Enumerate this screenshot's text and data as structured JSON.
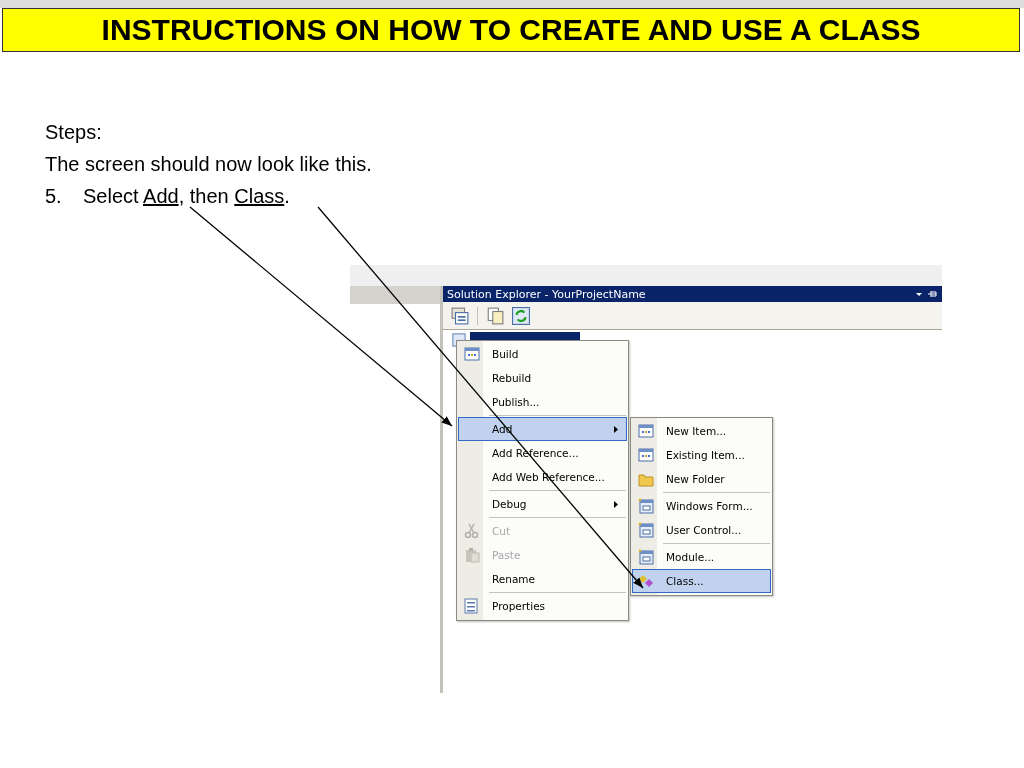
{
  "title": "INSTRUCTIONS ON HOW TO CREATE AND USE A CLASS",
  "lines": [
    {
      "parts": [
        {
          "text": "Steps:",
          "underlined": false
        }
      ]
    },
    {
      "parts": [
        {
          "text": "The screen should now look like this.",
          "underlined": false
        }
      ]
    },
    {
      "number": "5.",
      "parts": [
        {
          "text": "Select ",
          "underlined": false
        },
        {
          "text": "Add",
          "underlined": true
        },
        {
          "text": ", then ",
          "underlined": false
        },
        {
          "text": "Class",
          "underlined": true
        },
        {
          "text": ".",
          "underlined": false
        }
      ]
    }
  ],
  "solution_explorer": {
    "title": "Solution Explorer - YourProjectName"
  },
  "context_menu": [
    {
      "kind": "item",
      "label": "Build",
      "selected": false,
      "disabled": false,
      "submenu": false
    },
    {
      "kind": "item",
      "label": "Rebuild",
      "selected": false,
      "disabled": false,
      "submenu": false
    },
    {
      "kind": "item",
      "label": "Publish...",
      "selected": false,
      "disabled": false,
      "submenu": false
    },
    {
      "kind": "separator"
    },
    {
      "kind": "item",
      "label": "Add",
      "selected": true,
      "disabled": false,
      "submenu": true
    },
    {
      "kind": "item",
      "label": "Add Reference...",
      "selected": false,
      "disabled": false,
      "submenu": false
    },
    {
      "kind": "item",
      "label": "Add Web Reference...",
      "selected": false,
      "disabled": false,
      "submenu": false
    },
    {
      "kind": "separator"
    },
    {
      "kind": "item",
      "label": "Debug",
      "selected": false,
      "disabled": false,
      "submenu": true
    },
    {
      "kind": "separator"
    },
    {
      "kind": "item",
      "label": "Cut",
      "selected": false,
      "disabled": true,
      "submenu": false
    },
    {
      "kind": "item",
      "label": "Paste",
      "selected": false,
      "disabled": true,
      "submenu": false
    },
    {
      "kind": "item",
      "label": "Rename",
      "selected": false,
      "disabled": false,
      "submenu": false
    },
    {
      "kind": "separator"
    },
    {
      "kind": "item",
      "label": "Properties",
      "selected": false,
      "disabled": false,
      "submenu": false
    }
  ],
  "add_submenu": [
    {
      "kind": "item",
      "label": "New Item...",
      "selected": false,
      "disabled": false,
      "submenu": false
    },
    {
      "kind": "item",
      "label": "Existing Item...",
      "selected": false,
      "disabled": false,
      "submenu": false
    },
    {
      "kind": "item",
      "label": "New Folder",
      "selected": false,
      "disabled": false,
      "submenu": false
    },
    {
      "kind": "separator"
    },
    {
      "kind": "item",
      "label": "Windows Form...",
      "selected": false,
      "disabled": false,
      "submenu": false
    },
    {
      "kind": "item",
      "label": "User Control...",
      "selected": false,
      "disabled": false,
      "submenu": false
    },
    {
      "kind": "separator"
    },
    {
      "kind": "item",
      "label": "Module...",
      "selected": false,
      "disabled": false,
      "submenu": false
    },
    {
      "kind": "item",
      "label": "Class...",
      "selected": true,
      "disabled": false,
      "submenu": false
    }
  ]
}
